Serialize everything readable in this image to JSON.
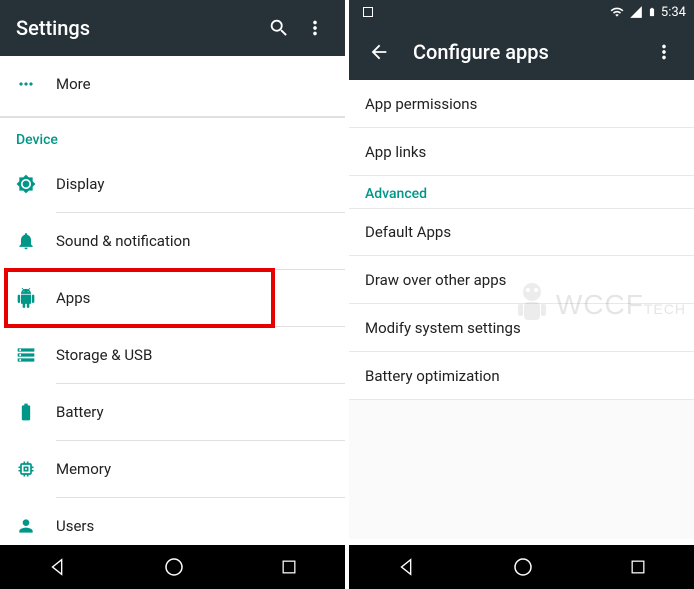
{
  "left": {
    "title": "Settings",
    "more_label": "More",
    "section": "Device",
    "items": {
      "display": "Display",
      "sound": "Sound & notification",
      "apps": "Apps",
      "storage": "Storage & USB",
      "battery": "Battery",
      "memory": "Memory",
      "users": "Users"
    }
  },
  "right": {
    "status_time": "5:34",
    "title": "Configure apps",
    "items": {
      "permissions": "App permissions",
      "links": "App links",
      "default_apps": "Default Apps",
      "draw_over": "Draw over other apps",
      "modify": "Modify system settings",
      "battery_opt": "Battery optimization"
    },
    "section": "Advanced"
  },
  "watermark": "WCCF",
  "watermark_suffix": "TECH"
}
